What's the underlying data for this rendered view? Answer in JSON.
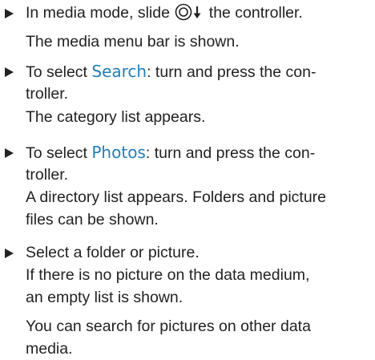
{
  "step1": {
    "text_before_icon": "In media mode, slide ",
    "text_after_icon": " the controller.",
    "icon": "controller-slide-down-icon",
    "result": "The media menu bar is shown."
  },
  "step2": {
    "prefix": "To select ",
    "keyword": "Search",
    "suffix_line1": ": turn and press the con-",
    "line2": "troller.",
    "result": "The category list appears."
  },
  "step3": {
    "prefix": "To select ",
    "keyword": "Photos",
    "suffix_line1": ": turn and press the con-",
    "line2": "troller.",
    "result_line1": "A directory list appears. Folders and picture",
    "result_line2": "files can be shown."
  },
  "step4": {
    "text": "Select a folder or picture.",
    "result_line1": "If there is no picture on the data medium,",
    "result_line2": "an empty list is shown.",
    "note_line1": "You can search for pictures on other data",
    "note_line2": "media."
  },
  "colors": {
    "text": "#222222",
    "highlight": "#1e7fc2"
  }
}
